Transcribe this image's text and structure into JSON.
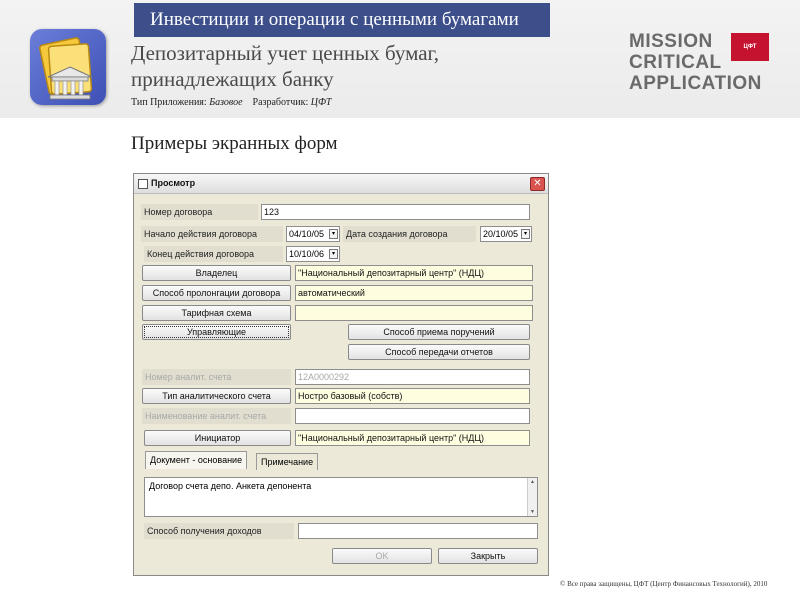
{
  "header": {
    "banner": "Инвестиции и операции с ценными бумагами",
    "title_line1": "Депозитарный учет ценных бумаг,",
    "title_line2": "принадлежащих банку",
    "meta_type_label": "Тип Приложения:",
    "meta_type_value": "Базовое",
    "meta_dev_label": "Разработчик:",
    "meta_dev_value": "ЦФТ",
    "logo_line1": "MISSION",
    "logo_line2": "CRITICAL",
    "logo_line3": "APPLICATION",
    "logo_box_text": "ЦФТ"
  },
  "section_title": "Примеры экранных форм",
  "dialog": {
    "title": "Просмотр",
    "close_glyph": "✕",
    "contract_number_label": "Номер договора",
    "contract_number_value": "123",
    "contract_start_label": "Начало действия договора",
    "contract_start_value": "04/10/05",
    "created_label": "Дата создания договора",
    "created_value": "20/10/05",
    "contract_end_label": "Конец действия договора",
    "contract_end_value": "10/10/06",
    "owner_button": "Владелец",
    "owner_value": "\"Национальный депозитарный центр\" (НДЦ)",
    "prolongation_button": "Способ пролонгации договора",
    "prolongation_value": "автоматический",
    "tariff_button": "Тарифная схема",
    "tariff_value": "",
    "managers_button": "Управляющие",
    "order_method_button": "Способ приема поручений",
    "report_method_button": "Способ передачи отчетов",
    "account_number_label": "Номер аналит. счета",
    "account_number_value": "12А0000292",
    "account_type_button": "Тип аналитического счета",
    "account_type_value": "Ностро базовый (собств)",
    "account_name_label": "Наименование аналит. счета",
    "account_name_value": "",
    "initiator_button": "Инициатор",
    "initiator_value": "\"Национальный депозитарный центр\" (НДЦ)",
    "tabs": [
      {
        "label": "Документ - основание"
      },
      {
        "label": "Примечание"
      }
    ],
    "memo_text": "Договор счета депо. Анкета депонента",
    "income_method_label": "Способ получения доходов",
    "income_method_value": "",
    "ok_button": "OK",
    "close_button": "Закрыть"
  },
  "footer": "© Все права защищены, ЦФТ (Центр Финансовых Технологий), 2010",
  "colors": {
    "banner": "#3c4f8a",
    "logo_red": "#c4122f",
    "field_yellow": "#fffde0"
  }
}
